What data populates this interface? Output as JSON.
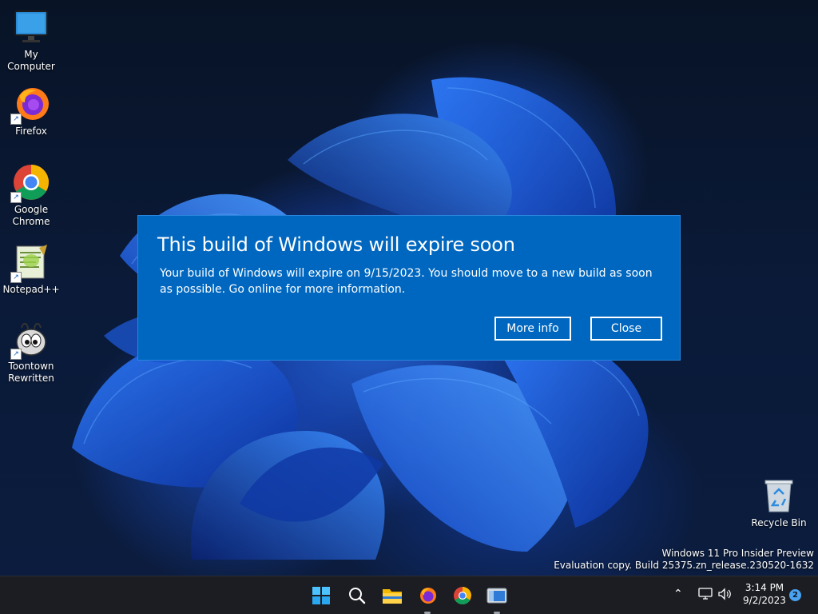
{
  "desktop": {
    "icons": [
      {
        "label": "My Computer",
        "icon": "monitor-icon"
      },
      {
        "label": "Firefox",
        "icon": "firefox-icon"
      },
      {
        "label": "Google Chrome",
        "icon": "chrome-icon"
      },
      {
        "label": "Notepad++",
        "icon": "notepadpp-icon"
      },
      {
        "label": "Toontown Rewritten",
        "icon": "toontown-icon"
      },
      {
        "label": "Recycle Bin",
        "icon": "recycle-bin-icon"
      }
    ],
    "watermark": {
      "line1": "Windows 11 Pro Insider Preview",
      "line2": "Evaluation copy. Build 25375.zn_release.230520-1632"
    }
  },
  "dialog": {
    "title": "This build of Windows will expire soon",
    "body": "Your build of Windows will expire on 9/15/2023. You should move to a new build as soon as possible. Go online for more information.",
    "more_info_label": "More info",
    "close_label": "Close",
    "background_color": "#0067c0"
  },
  "taskbar": {
    "items": [
      "start-icon",
      "search-icon",
      "file-explorer-icon",
      "firefox-icon",
      "chrome-icon",
      "app-window-icon"
    ],
    "tray": {
      "time": "3:14 PM",
      "date": "9/2/2023",
      "notification_count": "2"
    }
  }
}
